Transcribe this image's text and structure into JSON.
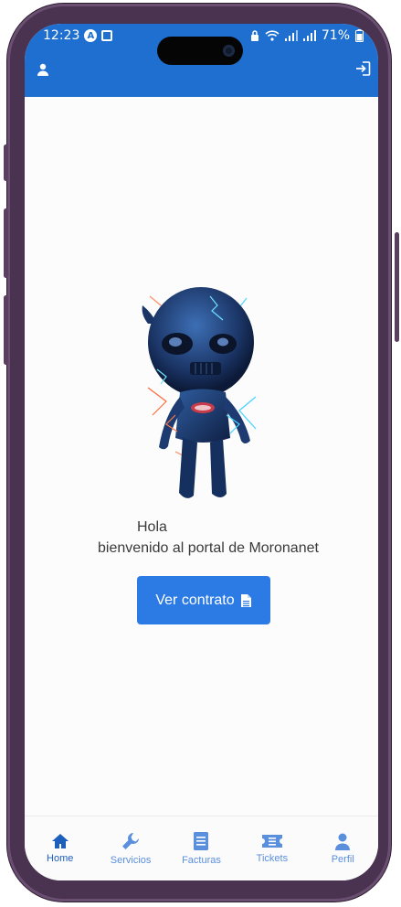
{
  "status_bar": {
    "time": "12:23",
    "battery": "71%"
  },
  "header": {
    "profile_icon": "user-icon",
    "logout_icon": "sign-out-icon"
  },
  "main": {
    "greeting": "Hola",
    "welcome": "bienvenido al portal de Moronanet",
    "cta_label": "Ver contrato",
    "cta_icon": "document-icon"
  },
  "bottom_nav": {
    "items": [
      {
        "label": "Home",
        "icon": "home-icon",
        "active": true
      },
      {
        "label": "Servicios",
        "icon": "wrench-icon",
        "active": false
      },
      {
        "label": "Facturas",
        "icon": "receipt-icon",
        "active": false
      },
      {
        "label": "Tickets",
        "icon": "ticket-icon",
        "active": false
      },
      {
        "label": "Perfil",
        "icon": "user-icon",
        "active": false
      }
    ]
  },
  "colors": {
    "primary": "#1e6fd0",
    "button": "#2c7be5",
    "nav_active": "#1d5fbd",
    "nav_inactive": "#5a8fdd",
    "frame": "#4a3350"
  }
}
